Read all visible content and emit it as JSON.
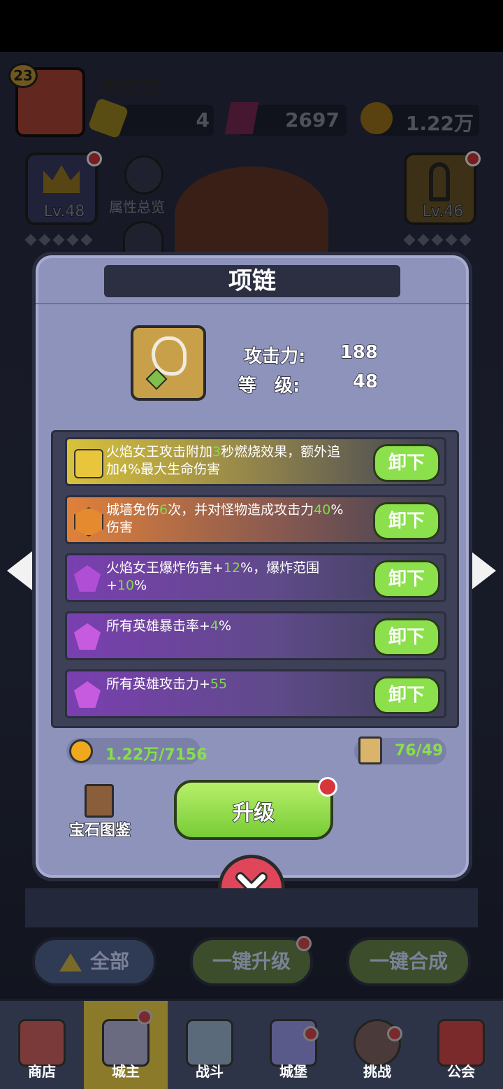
{
  "player": {
    "level": "23",
    "name": "杰杰杰"
  },
  "resources": {
    "energy": "4",
    "gems": "2697",
    "gold": "1.22万"
  },
  "side": {
    "crown_level": "Lv.48",
    "attr_overview": "属性总览",
    "staff_level": "Lv.46"
  },
  "modal": {
    "title": "项链",
    "stats": {
      "attack_label": "攻击力:",
      "attack_value": "188",
      "level_label": "等　级:",
      "level_value": "48"
    },
    "gems": [
      {
        "pre": "火焰女王攻击附加",
        "hl": "3",
        "post": "秒燃烧效果，额外追加4%最大生命伤害",
        "pre2": "",
        "hl2": "",
        "post2": "",
        "button": "卸下",
        "color": "yellow"
      },
      {
        "pre": "城墙免伤",
        "hl": "6",
        "post": "次，并对怪物造成攻击力",
        "hl2": "40",
        "post2": "%伤害",
        "button": "卸下",
        "color": "orange"
      },
      {
        "pre": "火焰女王爆炸伤害+",
        "hl": "12",
        "post": "%，爆炸范围+",
        "hl2": "10",
        "post2": "%",
        "button": "卸下",
        "color": "purple"
      },
      {
        "pre": "所有英雄暴击率+",
        "hl": "4",
        "post": "%",
        "hl2": "",
        "post2": "",
        "button": "卸下",
        "color": "purple"
      },
      {
        "pre": "所有英雄攻击力+",
        "hl": "55",
        "post": "",
        "hl2": "",
        "post2": "",
        "button": "卸下",
        "color": "purple"
      }
    ],
    "gold_cost": "1.22万/7156",
    "scroll_cost": "76/49",
    "gem_guide": "宝石图鉴",
    "upgrade": "升级"
  },
  "bottom_buttons": {
    "all": "全部",
    "one_upgrade": "一键升级",
    "one_merge": "一键合成"
  },
  "nav": [
    "商店",
    "城主",
    "战斗",
    "城堡",
    "挑战",
    "公会"
  ],
  "colors": {
    "accent_green": "#8be04c",
    "highlight_green": "#7fdc4a",
    "panel": "#8e93bc",
    "badge_red": "#d6363c"
  }
}
